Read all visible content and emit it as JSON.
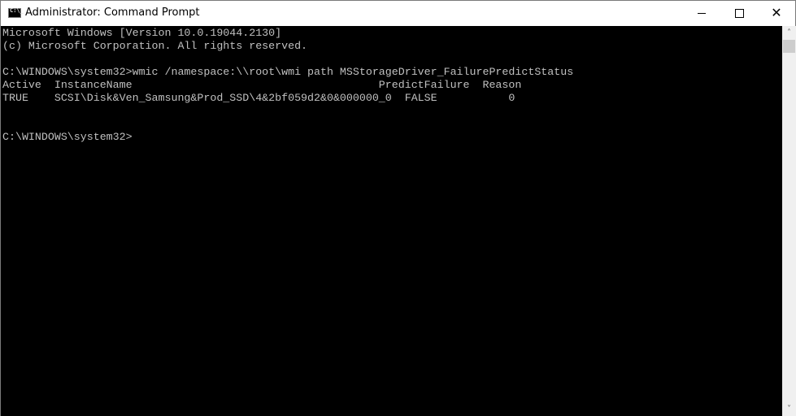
{
  "window": {
    "title": "Administrator: Command Prompt",
    "icon": "cmd-icon",
    "controls": {
      "minimize": "minimize-icon",
      "maximize": "maximize-icon",
      "close_glyph": "✕"
    }
  },
  "console": {
    "lines": [
      "Microsoft Windows [Version 10.0.19044.2130]",
      "(c) Microsoft Corporation. All rights reserved.",
      "",
      "C:\\WINDOWS\\system32>wmic /namespace:\\\\root\\wmi path MSStorageDriver_FailurePredictStatus",
      "Active  InstanceName                                      PredictFailure  Reason",
      "TRUE    SCSI\\Disk&Ven_Samsung&Prod_SSD\\4&2bf059d2&0&000000_0  FALSE           0",
      "",
      "",
      "C:\\WINDOWS\\system32>"
    ]
  },
  "scrollbar": {
    "up_glyph": "˄",
    "down_glyph": "˅"
  }
}
